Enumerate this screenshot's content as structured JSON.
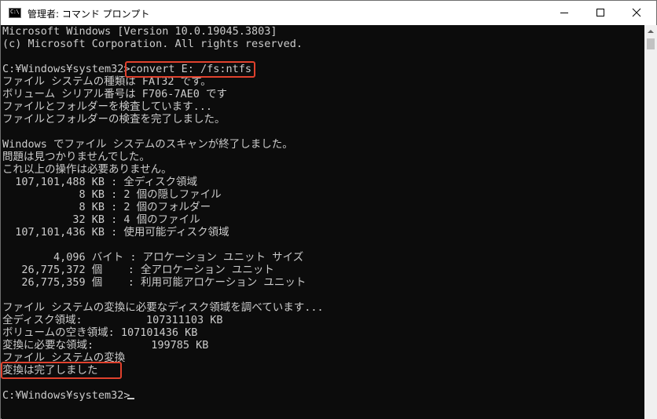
{
  "window": {
    "title": "管理者: コマンド プロンプト",
    "icon_text": "C:\\",
    "buttons": {
      "minimize": "minimize-icon",
      "maximize": "maximize-icon",
      "close": "close-icon"
    }
  },
  "console": {
    "lines": [
      "Microsoft Windows [Version 10.0.19045.3803]",
      "(c) Microsoft Corporation. All rights reserved.",
      "",
      "C:¥Windows¥system32>convert E: /fs:ntfs",
      "ファイル システムの種類は FAT32 です。",
      "ボリューム シリアル番号は F706-7AE0 です",
      "ファイルとフォルダーを検査しています...",
      "ファイルとフォルダーの検査を完了しました。",
      "",
      "Windows でファイル システムのスキャンが終了しました。",
      "問題は見つかりませんでした。",
      "これ以上の操作は必要ありません。",
      "  107,101,488 KB : 全ディスク領域",
      "            8 KB : 2 個の隠しファイル",
      "            8 KB : 2 個のフォルダー",
      "           32 KB : 4 個のファイル",
      "  107,101,436 KB : 使用可能ディスク領域",
      "",
      "        4,096 バイト : アロケーション ユニット サイズ",
      "   26,775,372 個    : 全アロケーション ユニット",
      "   26,775,359 個    : 利用可能アロケーション ユニット",
      "",
      "ファイル システムの変換に必要なディスク領域を調べています...",
      "全ディスク領域:          107311103 KB",
      "ボリュームの空き領域: 107101436 KB",
      "変換に必要な領域:         199785 KB",
      "ファイル システムの変換",
      "変換は完了しました",
      "",
      "C:¥Windows¥system32>"
    ],
    "highlight_color": "#e0412d",
    "text_color": "#cccccc",
    "background_color": "#0c0c0c"
  }
}
